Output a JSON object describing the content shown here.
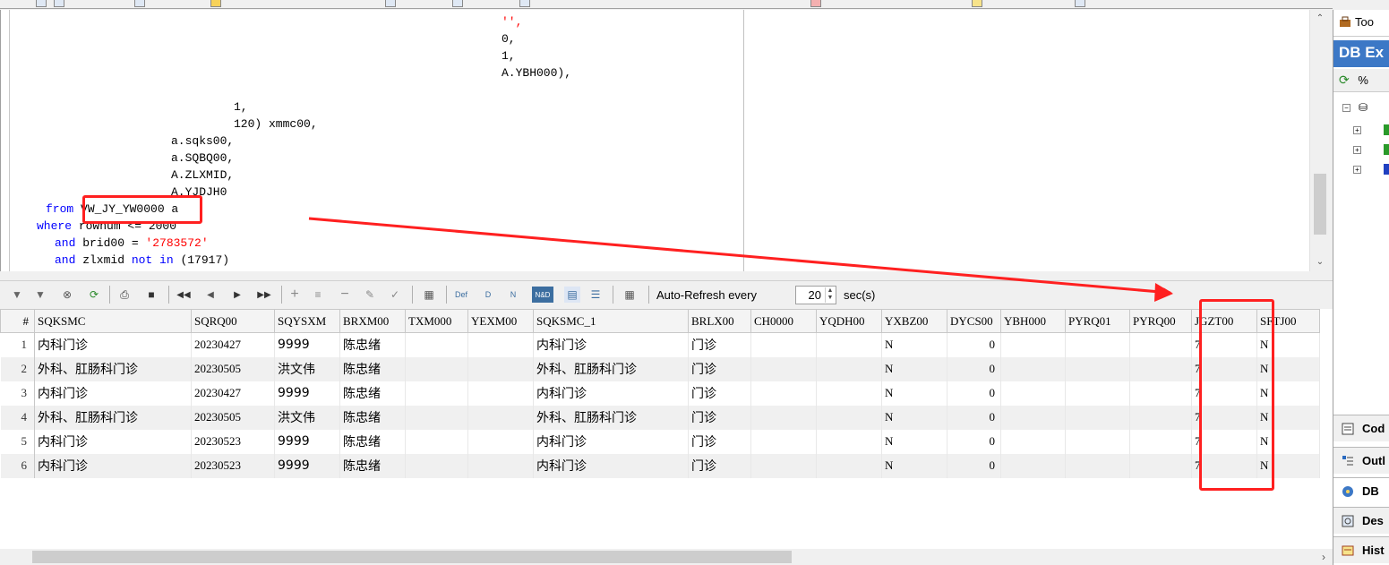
{
  "editor": {
    "lines": [
      {
        "indent": 545,
        "parts": [
          {
            "t": "'',",
            "c": "str"
          }
        ]
      },
      {
        "indent": 545,
        "parts": [
          {
            "t": "0,",
            "c": "plain"
          }
        ]
      },
      {
        "indent": 545,
        "parts": [
          {
            "t": "1,",
            "c": "plain"
          }
        ]
      },
      {
        "indent": 545,
        "parts": [
          {
            "t": "A.YBH000),",
            "c": "plain"
          }
        ]
      },
      {
        "indent": 0,
        "parts": []
      },
      {
        "indent": 246,
        "parts": [
          {
            "t": "1,",
            "c": "plain"
          }
        ]
      },
      {
        "indent": 246,
        "parts": [
          {
            "t": "120) xmmc00,",
            "c": "plain"
          }
        ]
      },
      {
        "indent": 176,
        "parts": [
          {
            "t": "a.sqks00,",
            "c": "plain"
          }
        ]
      },
      {
        "indent": 176,
        "parts": [
          {
            "t": "a.SQBQ00,",
            "c": "plain"
          }
        ]
      },
      {
        "indent": 176,
        "parts": [
          {
            "t": "A.ZLXMID,",
            "c": "plain"
          }
        ]
      },
      {
        "indent": 176,
        "parts": [
          {
            "t": "A.YJDJH0",
            "c": "plain"
          }
        ]
      },
      {
        "indent": 36,
        "parts": [
          {
            "t": "from",
            "c": "kw"
          },
          {
            "t": " VW_JY_YW0000 a",
            "c": "plain"
          }
        ]
      },
      {
        "indent": 26,
        "parts": [
          {
            "t": "where",
            "c": "kw"
          },
          {
            "t": " rownum <= 2000",
            "c": "plain"
          }
        ]
      },
      {
        "indent": 46,
        "parts": [
          {
            "t": "and",
            "c": "kw"
          },
          {
            "t": " brid00 = ",
            "c": "plain"
          },
          {
            "t": "'2783572'",
            "c": "str"
          }
        ]
      },
      {
        "indent": 46,
        "parts": [
          {
            "t": "and",
            "c": "kw"
          },
          {
            "t": " zlxmid ",
            "c": "plain"
          },
          {
            "t": "not in",
            "c": "kw"
          },
          {
            "t": " (17917)",
            "c": "plain"
          }
        ]
      }
    ]
  },
  "result_toolbar": {
    "auto_refresh_label": "Auto-Refresh every",
    "refresh_seconds": "20",
    "seconds_label": "sec(s)"
  },
  "grid": {
    "row_num_header": "#",
    "columns": [
      "SQKSMC",
      "SQRQ00",
      "SQYSXM",
      "BRXM00",
      "TXM000",
      "YEXM00",
      "SQKSMC_1",
      "BRLX00",
      "CH0000",
      "YQDH00",
      "YXBZ00",
      "DYCS00",
      "YBH000",
      "PYRQ01",
      "PYRQ00",
      "JGZT00",
      "SFTJ00"
    ],
    "rows": [
      {
        "n": "1",
        "cells": [
          "内科门诊",
          "20230427",
          "9999",
          "陈忠绪",
          "",
          "",
          "内科门诊",
          "门诊",
          "",
          "",
          "N",
          "0",
          "",
          "",
          "",
          "7",
          "N"
        ]
      },
      {
        "n": "2",
        "cells": [
          "外科、肛肠科门诊",
          "20230505",
          "洪文伟",
          "陈忠绪",
          "",
          "",
          "外科、肛肠科门诊",
          "门诊",
          "",
          "",
          "N",
          "0",
          "",
          "",
          "",
          "7",
          "N"
        ]
      },
      {
        "n": "3",
        "cells": [
          "内科门诊",
          "20230427",
          "9999",
          "陈忠绪",
          "",
          "",
          "内科门诊",
          "门诊",
          "",
          "",
          "N",
          "0",
          "",
          "",
          "",
          "7",
          "N"
        ]
      },
      {
        "n": "4",
        "cells": [
          "外科、肛肠科门诊",
          "20230505",
          "洪文伟",
          "陈忠绪",
          "",
          "",
          "外科、肛肠科门诊",
          "门诊",
          "",
          "",
          "N",
          "0",
          "",
          "",
          "",
          "7",
          "N"
        ]
      },
      {
        "n": "5",
        "cells": [
          "内科门诊",
          "20230523",
          "9999",
          "陈忠绪",
          "",
          "",
          "内科门诊",
          "门诊",
          "",
          "",
          "N",
          "0",
          "",
          "",
          "",
          "7",
          "N"
        ]
      },
      {
        "n": "6",
        "cells": [
          "内科门诊",
          "20230523",
          "9999",
          "陈忠绪",
          "",
          "",
          "内科门诊",
          "门诊",
          "",
          "",
          "N",
          "0",
          "",
          "",
          "",
          "7",
          "N"
        ]
      }
    ]
  },
  "right_panel": {
    "tab_label": "Too",
    "title": "DB Ex",
    "tool_text": "%",
    "bottom_tabs": [
      "Cod",
      "Outl",
      "DB",
      "Des",
      "Hist"
    ]
  },
  "colors": {
    "accent": "#3c78c6",
    "annotation": "#ff2020",
    "keyword": "#0000ff",
    "string": "#ff0000"
  }
}
